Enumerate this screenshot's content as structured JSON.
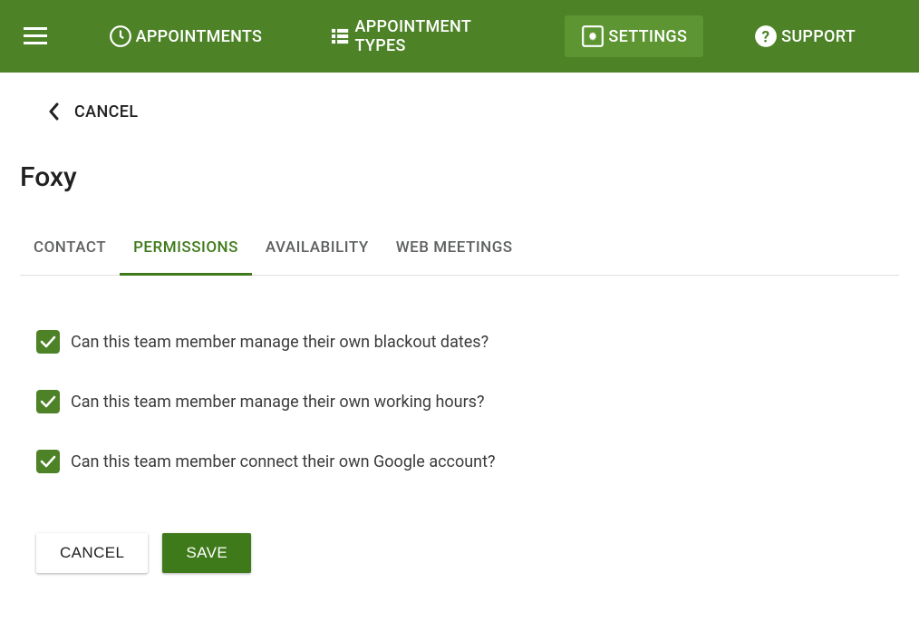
{
  "nav": {
    "appointments": "APPOINTMENTS",
    "appointment_types": "APPOINTMENT TYPES",
    "settings": "SETTINGS",
    "support": "SUPPORT"
  },
  "back": {
    "label": "CANCEL"
  },
  "page_title": "Foxy",
  "tabs": {
    "contact": "CONTACT",
    "permissions": "PERMISSIONS",
    "availability": "AVAILABILITY",
    "web_meetings": "WEB MEETINGS"
  },
  "permissions": {
    "blackout": {
      "label": "Can this team member manage their own blackout dates?",
      "checked": true
    },
    "working_hours": {
      "label": "Can this team member manage their own working hours?",
      "checked": true
    },
    "google": {
      "label": "Can this team member connect their own Google account?",
      "checked": true
    }
  },
  "actions": {
    "cancel": "CANCEL",
    "save": "SAVE"
  }
}
